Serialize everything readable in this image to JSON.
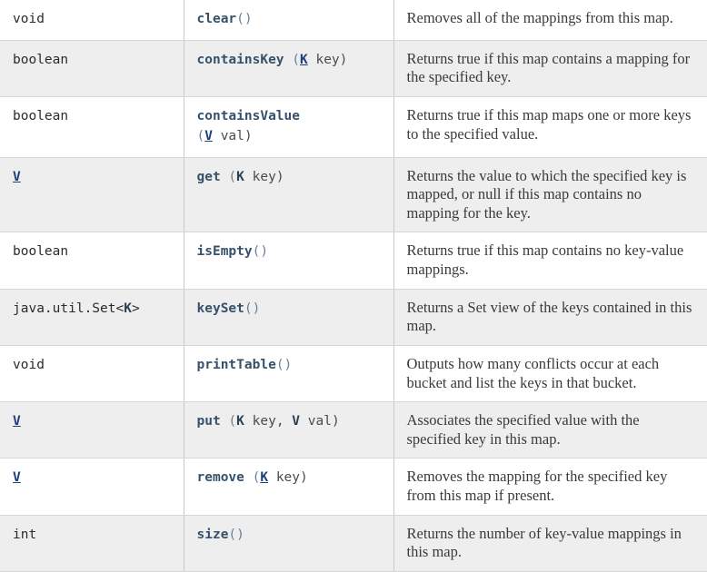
{
  "table": {
    "columns": [
      "return_type",
      "method_signature",
      "description"
    ],
    "rows": [
      {
        "return_type": "void",
        "type_is_link": false,
        "method": "clear",
        "params_prefix": "",
        "params": "()",
        "signature_text": "clear()",
        "description": "Removes all of the mappings from this map."
      },
      {
        "return_type": "boolean",
        "type_is_link": false,
        "method": "containsKey",
        "params_prefix": " (",
        "generic_link": "K",
        "params_tail": " key)",
        "signature_text": "containsKey (K key)",
        "description": "Returns true if this map contains a mapping for the specified key."
      },
      {
        "return_type": "boolean",
        "type_is_link": false,
        "method": "containsValue",
        "params_prefix": "(",
        "generic_link": "V",
        "params_tail": " val)",
        "signature_text": "containsValue (V val)",
        "description": "Returns true if this map maps one or more keys to the specified value."
      },
      {
        "return_type": "V",
        "type_is_link": true,
        "method": "get",
        "params_prefix": " (",
        "generic_plain": "K",
        "params_tail": " key)",
        "signature_text": "get (K key)",
        "description": "Returns the value to which the specified key is mapped, or null if this map contains no mapping for the key."
      },
      {
        "return_type": "boolean",
        "type_is_link": false,
        "method": "isEmpty",
        "params_prefix": "",
        "params": "()",
        "signature_text": "isEmpty()",
        "description": "Returns true if this map contains no key-value mappings."
      },
      {
        "return_type": "java.util.Set<K>",
        "type_prefix": "java.util.Set<",
        "type_generic": "K",
        "type_suffix": ">",
        "type_is_link": false,
        "method": "keySet",
        "params_prefix": "",
        "params": "()",
        "signature_text": "keySet()",
        "description": "Returns a Set view of the keys contained in this map."
      },
      {
        "return_type": "void",
        "type_is_link": false,
        "method": "printTable",
        "params_prefix": "",
        "params": "()",
        "signature_text": "printTable()",
        "description": "Outputs how many conflicts occur at each bucket and list the keys in that bucket."
      },
      {
        "return_type": "V",
        "type_is_link": true,
        "method": "put",
        "params_prefix": " (",
        "generic_plain": "K",
        "params_mid": " key, ",
        "generic_plain_2": "V",
        "params_tail": " val)",
        "signature_text": "put (K key, V val)",
        "description": "Associates the specified value with the specified key in this map."
      },
      {
        "return_type": "V",
        "type_is_link": true,
        "method": "remove",
        "params_prefix": " (",
        "generic_link": "K",
        "params_tail": " key)",
        "signature_text": "remove (K key)",
        "description": "Removes the mapping for the specified key from this map if present."
      },
      {
        "return_type": "int",
        "type_is_link": false,
        "method": "size",
        "params_prefix": "",
        "params": "()",
        "signature_text": "size()",
        "description": "Returns the number of key-value mappings in this map."
      }
    ]
  },
  "colors": {
    "row_shade": "#eeeeee",
    "row_plain": "#ffffff",
    "method_name": "#36516b",
    "link": "#1f3f7a",
    "punctuation": "#6a7f92",
    "border": "#d6d6d6",
    "description_text": "#3a3a3a"
  }
}
